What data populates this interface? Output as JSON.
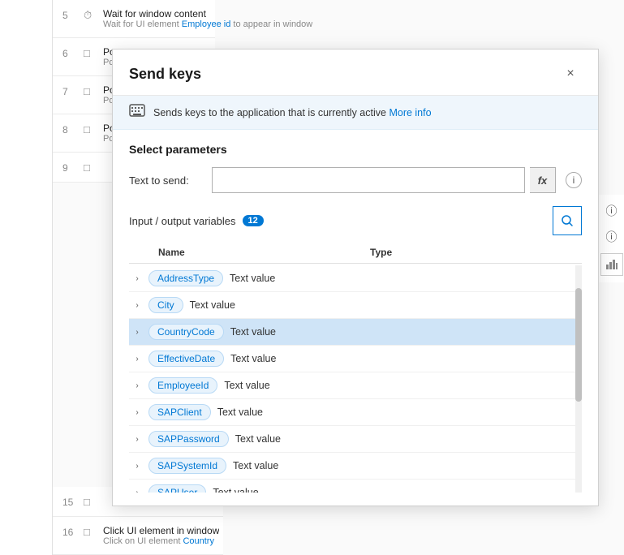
{
  "workflow": {
    "items": [
      {
        "num": "5",
        "icon": "wait-icon",
        "title": "Wait for window content",
        "sub": "Wait for UI element ",
        "highlight": "Employee id",
        "sub2": " to appear in window"
      },
      {
        "num": "6",
        "icon": "popup-icon",
        "title": "Pop",
        "sub": "Pop"
      },
      {
        "num": "7",
        "icon": "popup-icon",
        "title": "Pop",
        "sub": "Pop"
      },
      {
        "num": "8",
        "icon": "popup-icon",
        "title": "Pop",
        "sub": "Pop"
      },
      {
        "num": "9",
        "icon": "popup-icon",
        "title": "",
        "sub": ""
      }
    ],
    "bottom_items": [
      {
        "num": "15",
        "icon": "popup-icon",
        "title": "",
        "sub": ""
      },
      {
        "num": "16",
        "icon": "click-icon",
        "title": "Click UI element in window",
        "sub": "Click on UI element ",
        "highlight": "Country",
        "sub2": ""
      }
    ]
  },
  "modal": {
    "title": "Send keys",
    "close_label": "×",
    "info_text": "Sends keys to the application that is currently active",
    "info_link": "More info",
    "section_title": "Select parameters",
    "form": {
      "label": "Text to send:",
      "placeholder": "",
      "fx_label": "fx"
    },
    "variables": {
      "label": "Input / output variables",
      "count": "12",
      "search_placeholder": "Search",
      "columns": {
        "name": "Name",
        "type": "Type"
      },
      "rows": [
        {
          "id": "AddressType",
          "type": "Text value",
          "selected": false
        },
        {
          "id": "City",
          "type": "Text value",
          "selected": false
        },
        {
          "id": "CountryCode",
          "type": "Text value",
          "selected": true
        },
        {
          "id": "EffectiveDate",
          "type": "Text value",
          "selected": false
        },
        {
          "id": "EmployeeId",
          "type": "Text value",
          "selected": false
        },
        {
          "id": "SAPClient",
          "type": "Text value",
          "selected": false
        },
        {
          "id": "SAPPassword",
          "type": "Text value",
          "selected": false
        },
        {
          "id": "SAPSystemId",
          "type": "Text value",
          "selected": false
        },
        {
          "id": "SAPUser",
          "type": "Text value",
          "selected": false
        }
      ]
    }
  },
  "icons": {
    "search": "🔍",
    "info_circle": "ⓘ",
    "expand": "›",
    "close": "✕",
    "wait": "⏱",
    "popup": "□",
    "keyboard": "⌨"
  }
}
